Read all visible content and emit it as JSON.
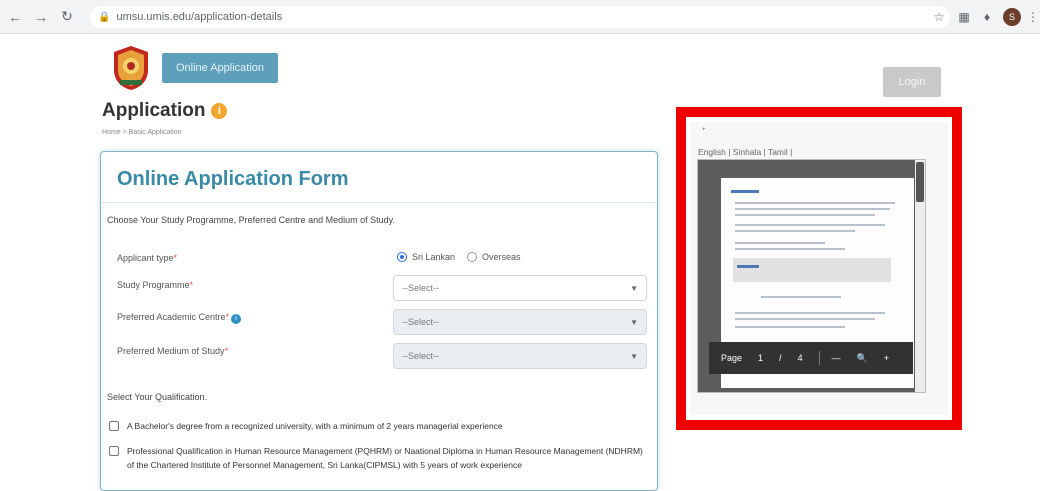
{
  "browser": {
    "url": "umsu.umis.edu/application-details",
    "back_icon": "back-arrow-icon",
    "profile_initial": "S"
  },
  "header": {
    "online_application_label": "Online Application",
    "login_label": "Login"
  },
  "page": {
    "title": "Application",
    "title_badge": "i",
    "breadcrumb": "Home > Basic Application"
  },
  "form": {
    "title": "Online Application Form",
    "intro": "Choose Your Study Programme, Preferred Centre and Medium of Study.",
    "applicant_type_label": "Applicant type",
    "applicant_type_options": [
      "Sri Lankan",
      "Overseas"
    ],
    "applicant_type_selected": "Sri Lankan",
    "study_programme_label": "Study Programme",
    "study_programme_value": "--Select--",
    "academic_centre_label": "Preferred Academic Centre",
    "academic_centre_value": "--Select--",
    "medium_label": "Preferred Medium of Study",
    "medium_value": "--Select--",
    "required_mark": "*",
    "qualification_label": "Select Your Qualification.",
    "qualifications": [
      "A Bachelor's degree from a recognized university, with a minimum of 2 years managerial experience",
      "Professional Qualification in Human Resource Management (PQHRM) or Naational Diploma in Human Resource Management (NDHRM) of the Chartered Institute of Personnel Management, Sri Lanka(CIPMSL) with 5 years of work experience"
    ]
  },
  "pdf_preview": {
    "language_links": "English | Sinhala | Tamil |",
    "marker": "+",
    "toolbar": {
      "page_label": "Page",
      "current_page": "1",
      "separator": "/",
      "total_pages": "4",
      "zoom_out": "—",
      "zoom_in": "+"
    }
  },
  "colors": {
    "accent": "#3a8aa6",
    "button": "#5ea0bb",
    "highlight": "#ee0000"
  }
}
